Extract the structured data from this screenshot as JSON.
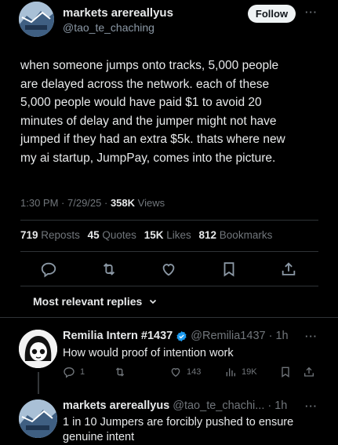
{
  "post": {
    "author_name": "markets arereallyus",
    "author_handle": "@tao_te_chaching",
    "follow_label": "Follow",
    "more_label": "···",
    "body_lines": [
      "when someone jumps onto tracks, 5,000 people",
      "are delayed across the network. each of these",
      "5,000 people would have paid $1 to avoid 20",
      "minutes of delay and the jumper might not have",
      "jumped if they had an extra $5k. thats where new",
      "my ai startup, JumpPay, comes into the picture."
    ],
    "time": "1:30 PM",
    "date": "7/29/25",
    "views_count": "358K",
    "views_label": "Views",
    "reposts_count": "719",
    "reposts_label": "Reposts",
    "quotes_count": "45",
    "quotes_label": "Quotes",
    "likes_count": "15K",
    "likes_label": "Likes",
    "bookmarks_count": "812",
    "bookmarks_label": "Bookmarks"
  },
  "actions": [
    "reply-icon",
    "repost-icon",
    "like-icon",
    "bookmark-icon",
    "share-icon"
  ],
  "replies_sort_label": "Most relevant replies",
  "replies": [
    {
      "name": "Remilia Intern #1437",
      "verified": true,
      "handle_time": "@Remilia1437 · 1h",
      "text_lines": [
        "How would proof of intention work"
      ],
      "reply_count": "1",
      "repost_count": "",
      "like_count": "143",
      "view_count": "19K"
    },
    {
      "name": "markets arereallyus",
      "handle_time": "@tao_te_chachi... · 1h",
      "text_lines": [
        "1 in 10 Jumpers are forcibly pushed to ensure",
        "genuine intent"
      ]
    }
  ],
  "colors": {
    "background": "#000000",
    "text": "#e7e9ea",
    "muted": "#71767b",
    "divider": "#2f3336",
    "verified": "#1d9bf0"
  }
}
